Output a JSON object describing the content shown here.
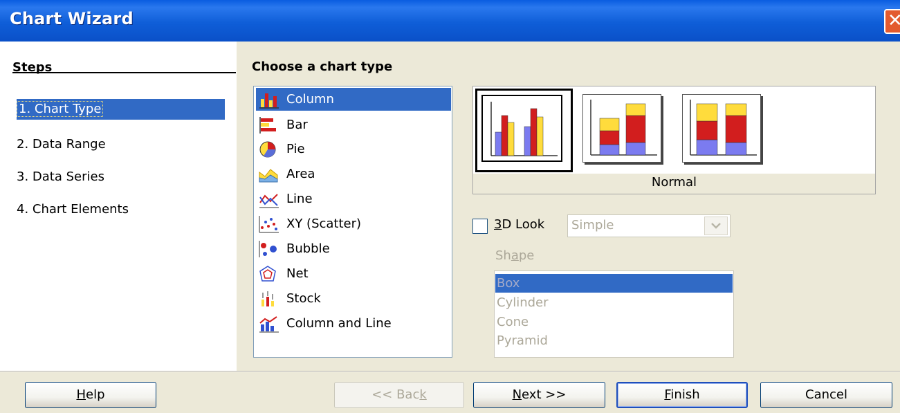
{
  "window": {
    "title": "Chart Wizard",
    "close_icon": "close-icon"
  },
  "steps": {
    "title": "Steps",
    "items": [
      {
        "label": "1. Chart Type",
        "selected": true
      },
      {
        "label": "2. Data Range",
        "selected": false
      },
      {
        "label": "3. Data Series",
        "selected": false
      },
      {
        "label": "4. Chart Elements",
        "selected": false
      }
    ]
  },
  "main": {
    "title": "Choose a chart type",
    "chart_types": [
      {
        "label": "Column",
        "icon": "column-chart-icon",
        "selected": true
      },
      {
        "label": "Bar",
        "icon": "bar-chart-icon"
      },
      {
        "label": "Pie",
        "icon": "pie-chart-icon"
      },
      {
        "label": "Area",
        "icon": "area-chart-icon"
      },
      {
        "label": "Line",
        "icon": "line-chart-icon"
      },
      {
        "label": "XY (Scatter)",
        "icon": "scatter-chart-icon"
      },
      {
        "label": "Bubble",
        "icon": "bubble-chart-icon"
      },
      {
        "label": "Net",
        "icon": "net-chart-icon"
      },
      {
        "label": "Stock",
        "icon": "stock-chart-icon"
      },
      {
        "label": "Column and Line",
        "icon": "column-and-line-chart-icon"
      }
    ],
    "variants": {
      "selected_label": "Normal",
      "items": [
        "normal-column-variant",
        "stacked-column-variant",
        "percent-stacked-column-variant"
      ]
    },
    "look3d": {
      "label_prefix": "",
      "label_mnemonic": "3",
      "label_rest": "D Look",
      "checked": false,
      "combo_value": "Simple"
    },
    "shape": {
      "label_pre": "Sh",
      "label_mnemonic": "a",
      "label_post": "pe",
      "options": [
        "Box",
        "Cylinder",
        "Cone",
        "Pyramid"
      ],
      "selected": "Box"
    }
  },
  "buttons": {
    "help": {
      "mnemonic": "H",
      "rest": "elp"
    },
    "back": {
      "pre": "<< Bac",
      "mnemonic": "k"
    },
    "next": {
      "mnemonic": "N",
      "rest": "ext >>"
    },
    "finish": {
      "mnemonic": "F",
      "rest": "inish"
    },
    "cancel": {
      "label": "Cancel"
    }
  },
  "colors": {
    "titlebar": "#0a5de0",
    "selection": "#316ac5",
    "bar_blue": "#7b7bf0",
    "bar_red": "#d21e1e",
    "bar_yellow": "#ffdc3c"
  }
}
